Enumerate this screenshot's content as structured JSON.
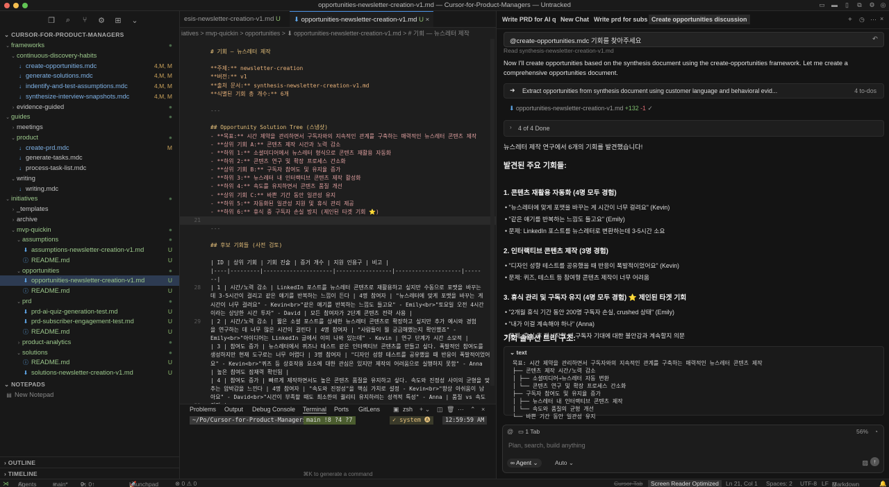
{
  "window": {
    "title": "opportunities-newsletter-creation-v1.md — Cursor-for-Product-Managers — Untracked"
  },
  "sidebar": {
    "project": "CURSOR-FOR-PRODUCT-MANAGERS",
    "tree": [
      {
        "label": "frameworks",
        "indent": 1,
        "type": "folder-open",
        "color": "green",
        "stat": "●"
      },
      {
        "label": "continuous-discovery-habits",
        "indent": 2,
        "type": "folder-open",
        "color": "green",
        "stat": ""
      },
      {
        "label": "create-opportunities.mdc",
        "indent": 3,
        "type": "file",
        "color": "blue",
        "stat": "4,M, M"
      },
      {
        "label": "generate-solutions.mdc",
        "indent": 3,
        "type": "file",
        "color": "blue",
        "stat": "4,M, M"
      },
      {
        "label": "indentify-and-test-assumptions.mdc",
        "indent": 3,
        "type": "file",
        "color": "blue",
        "stat": "4,M, M"
      },
      {
        "label": "synthesize-interview-snapshots.mdc",
        "indent": 3,
        "type": "file",
        "color": "blue",
        "stat": "4,M, M"
      },
      {
        "label": "evidence-guided",
        "indent": 2,
        "type": "folder",
        "color": "plain",
        "stat": "●"
      },
      {
        "label": "guides",
        "indent": 1,
        "type": "folder-open",
        "color": "green",
        "stat": "●"
      },
      {
        "label": "meetings",
        "indent": 2,
        "type": "folder",
        "color": "plain",
        "stat": ""
      },
      {
        "label": "product",
        "indent": 2,
        "type": "folder-open",
        "color": "green",
        "stat": "●"
      },
      {
        "label": "create-prd.mdc",
        "indent": 3,
        "type": "file",
        "color": "blue",
        "stat": "M"
      },
      {
        "label": "generate-tasks.mdc",
        "indent": 3,
        "type": "file",
        "color": "plain",
        "stat": ""
      },
      {
        "label": "process-task-list.mdc",
        "indent": 3,
        "type": "file",
        "color": "plain",
        "stat": ""
      },
      {
        "label": "writing",
        "indent": 2,
        "type": "folder-open",
        "color": "plain",
        "stat": ""
      },
      {
        "label": "writing.mdc",
        "indent": 3,
        "type": "file",
        "color": "plain",
        "stat": ""
      },
      {
        "label": "initiatives",
        "indent": 1,
        "type": "folder-open",
        "color": "green",
        "stat": "●"
      },
      {
        "label": "_templates",
        "indent": 2,
        "type": "folder",
        "color": "plain",
        "stat": ""
      },
      {
        "label": "archive",
        "indent": 2,
        "type": "folder",
        "color": "plain",
        "stat": ""
      },
      {
        "label": "mvp-quickin",
        "indent": 2,
        "type": "folder-open",
        "color": "green",
        "stat": "●"
      },
      {
        "label": "assumptions",
        "indent": 3,
        "type": "folder-open",
        "color": "green",
        "stat": "●"
      },
      {
        "label": "assumptions-newsletter-creation-v1.md",
        "indent": 4,
        "type": "file-down",
        "color": "green",
        "stat": "U"
      },
      {
        "label": "README.md",
        "indent": 4,
        "type": "file-info",
        "color": "green",
        "stat": "U"
      },
      {
        "label": "opportunities",
        "indent": 3,
        "type": "folder-open",
        "color": "green",
        "stat": "●"
      },
      {
        "label": "opportunities-newsletter-creation-v1.md",
        "indent": 4,
        "type": "file-down",
        "color": "green",
        "stat": "U",
        "selected": true
      },
      {
        "label": "README.md",
        "indent": 4,
        "type": "file-info",
        "color": "green",
        "stat": "U"
      },
      {
        "label": "prd",
        "indent": 3,
        "type": "folder-open",
        "color": "green",
        "stat": "●"
      },
      {
        "label": "prd-ai-quiz-generation-test.md",
        "indent": 4,
        "type": "file-down",
        "color": "green",
        "stat": "U"
      },
      {
        "label": "prd-subscriber-engagement-test.md",
        "indent": 4,
        "type": "file-down",
        "color": "green",
        "stat": "U"
      },
      {
        "label": "README.md",
        "indent": 4,
        "type": "file-info",
        "color": "green",
        "stat": "U"
      },
      {
        "label": "product-analytics",
        "indent": 3,
        "type": "folder",
        "color": "green",
        "stat": "●"
      },
      {
        "label": "solutions",
        "indent": 3,
        "type": "folder-open",
        "color": "green",
        "stat": "●"
      },
      {
        "label": "README.md",
        "indent": 4,
        "type": "file-info",
        "color": "green",
        "stat": "U"
      },
      {
        "label": "solutions-newsletter-creation-v1.md",
        "indent": 4,
        "type": "file-down",
        "color": "green",
        "stat": "U"
      }
    ],
    "notepads_section": "NOTEPADS",
    "new_notepad": "New Notepad",
    "outline_section": "OUTLINE",
    "timeline_section": "TIMELINE"
  },
  "editor": {
    "tabs": [
      {
        "label": "esis-newsletter-creation-v1.md",
        "status": "U",
        "active": false
      },
      {
        "label": "opportunities-newsletter-creation-v1.md",
        "status": "U",
        "active": true
      }
    ],
    "breadcrumb": "iatives > mvp-quickin > opportunities > ⬇ opportunities-newsletter-creation-v1.md > # 기회 — 뉴스레터 제작",
    "lines": [
      {
        "n": "",
        "t": "# 기회 — 뉴스레터 제작",
        "k": "h"
      },
      {
        "n": "",
        "t": "",
        "k": ""
      },
      {
        "n": "",
        "t": "**주제:** newsletter-creation",
        "k": "kv"
      },
      {
        "n": "",
        "t": "**버전:** v1",
        "k": "kv"
      },
      {
        "n": "",
        "t": "**출처 문서:** synthesis-newsletter-creation-v1.md",
        "k": "kv"
      },
      {
        "n": "",
        "t": "**식별된 기회 총 개수:** 6개",
        "k": "kv"
      },
      {
        "n": "",
        "t": "",
        "k": ""
      },
      {
        "n": "",
        "t": "---",
        "k": "dim"
      },
      {
        "n": "",
        "t": "",
        "k": ""
      },
      {
        "n": "",
        "t": "## Opportunity Solution Tree (스냅샷)",
        "k": "h"
      },
      {
        "n": "",
        "t": "- **목표:** 시간 제약을 관리하면서 구독자와의 지속적인 관계를 구축하는 매력적인 뉴스레터 콘텐츠 제작",
        "k": "li"
      },
      {
        "n": "",
        "t": "  - **상위 기회 A:** 콘텐츠 제작 시간과 노력 감소",
        "k": "li"
      },
      {
        "n": "",
        "t": "    - **하위 1:** 소셜미디어에서 뉴스레터 형식으로 콘텐츠 재활용 자동화",
        "k": "li"
      },
      {
        "n": "",
        "t": "    - **하위 2:** 콘텐츠 연구 및 확장 프로세스 간소화",
        "k": "li"
      },
      {
        "n": "",
        "t": "  - **상위 기회 B:** 구독자 참여도 및 유지율 증가",
        "k": "li"
      },
      {
        "n": "",
        "t": "    - **하위 3:** 뉴스레터 내 인터랙티브 콘텐츠 제작 활성화",
        "k": "li"
      },
      {
        "n": "",
        "t": "    - **하위 4:** 속도를 유지하면서 콘텐츠 품질 개선",
        "k": "li"
      },
      {
        "n": "",
        "t": "  - **상위 기회 C:** 바쁜 기간 동안 일관성 유지",
        "k": "li"
      },
      {
        "n": "",
        "t": "    - **하위 5:** 자동화된 일관성 지원 및 휴식 관리 제공",
        "k": "li"
      },
      {
        "n": "",
        "t": "    - **하위 6:** 휴식 중 구독자 손실 방지 (제인된 타겟 기회 ⭐)",
        "k": "li"
      },
      {
        "n": "21",
        "t": "",
        "k": "cur"
      },
      {
        "n": "",
        "t": "---",
        "k": "dim"
      },
      {
        "n": "",
        "t": "",
        "k": ""
      },
      {
        "n": "",
        "t": "## 후보 기회들 (사전 검토)",
        "k": "h"
      },
      {
        "n": "",
        "t": "",
        "k": ""
      },
      {
        "n": "",
        "t": "| ID | 상위 기회 | 기회 진술 | 증거 개수 | 지원 인용구 | 비고 |",
        "k": ""
      },
      {
        "n": "",
        "t": "|----|---------|---------------------|-----------------|--------------------|-----",
        "k": ""
      },
      {
        "n": "",
        "t": "--|",
        "k": ""
      },
      {
        "n": "28",
        "t": "| 1 | 시간/노력 감소 | LinkedIn 포스트를 뉴스레터 콘텐츠로 재활용하고 싶지만 수동으로 포맷을 바꾸는",
        "k": ""
      },
      {
        "n": "",
        "t": "데 3-5시간이 걸리고 같은 얘기를 반복하는 느낌이 든다 | 4명 참여자 | \"뉴스레터에 맞게 포맷을 바꾸는 게",
        "k": ""
      },
      {
        "n": "",
        "t": "시간이 너무 걸려요\" - Kevin<br>\"같은 얘기를 반복하는 느낌도 들고요\" - Emily<br>\"토요일 오전 4시간",
        "k": ""
      },
      {
        "n": "",
        "t": "이라는 상당한 시간 투자\" - David | 모든 참여자가 2단계 콘텐츠 전략 사용 |",
        "k": ""
      },
      {
        "n": "29",
        "t": "| 2 | 시간/노력 감소 | 짧은 소셜 포스트를 상세한 뉴스레터 콘텐츠로 확장하고 싶지만 추가 예시와 경험",
        "k": ""
      },
      {
        "n": "",
        "t": "을 연구하는 데 너무 많은 시간이 걸린다 | 4명 참여자 | \"사람들이 뭘 궁금해했는지 확인했죠\" -",
        "k": ""
      },
      {
        "n": "",
        "t": "Emily<br>\"아이디어는 LinkedIn 글에서 이미 나와 있는데\" - Kevin | 연구 단계가 시간 소모적 |",
        "k": ""
      },
      {
        "n": "",
        "t": "| 3 | 참여도 증가 | 뉴스레터에서 퀴즈나 테스트 같은 인터랙티브 콘텐츠를 만들고 싶다. 폭발적인 참여도를",
        "k": ""
      },
      {
        "n": "",
        "t": "생성하지만 현재 도구로는 너무 어렵다 | 3명 참여자 | \"디자인 성향 테스트를 공유했을 때 반응이 폭발적이었어",
        "k": ""
      },
      {
        "n": "",
        "t": "요\" - Kevin<br>\"퀴즈 등 상호작용 요소에 대한 관심은 있지만 제작의 어려움으로 실행하지 못함\" - Anna",
        "k": ""
      },
      {
        "n": "",
        "t": "| 높은 참여도 잠재력 확인됨 |",
        "k": ""
      },
      {
        "n": "",
        "t": "| 4 | 참여도 증가 | 빠르게 제작하면서도 높은 콘텐츠 품질을 유지하고 싶다. 속도와 진정성 사이의 균형을 맞",
        "k": ""
      },
      {
        "n": "",
        "t": "추는 압박감을 느낀다 | 4명 참여자 | \"속도와 진정성\"을 핵심 가치로 설정 - Kevin<br>\"항상 아쉬움이 남",
        "k": ""
      },
      {
        "n": "",
        "t": "아요\" - David<br>\"시간이 부족할 때도 최소한의 퀄리티 유지하려는 성격적 특성\" - Anna | 품질 vs 속도",
        "k": ""
      },
      {
        "n": "31",
        "t": "긴장 |",
        "k": ""
      }
    ]
  },
  "terminal": {
    "tabs": [
      "Problems",
      "Output",
      "Debug Console",
      "Terminal",
      "Ports",
      "GitLens"
    ],
    "shell": "zsh",
    "cwd": "~/Po/Cursor-for-Product-Managers",
    "branch": "main !8 ?4 ?7",
    "env": "✓ system 🅐",
    "time": "12:59:59 AM",
    "hint": "⌘K to generate a command"
  },
  "chat": {
    "tabs": [
      {
        "label": "Write PRD for AI q",
        "active": false
      },
      {
        "label": "New Chat",
        "active": false
      },
      {
        "label": "Write prd for subs",
        "active": false
      },
      {
        "label": "Create opportunities discussion",
        "active": true
      }
    ],
    "user_message": "@create-opportunities.mdc 기회를 찾아주세요",
    "read_line": "Read synthesis-newsletter-creation-v1.md",
    "intro": "Now I'll create opportunities based on the synthesis document using the create-opportunities framework. Let me create a",
    "intro2": "comprehensive opportunities document.",
    "todo_task": "Extract opportunities from synthesis document using customer language and behavioral evid...",
    "todo_count": "4 to-dos",
    "file_change": "opportunities-newsletter-creation-v1.md",
    "file_add": "+132",
    "file_del": "-1",
    "done": "4 of 4 Done",
    "summary": "뉴스레터 제작 연구에서 6개의 기회를 발견했습니다!",
    "found_heading": "발견된 주요 기회들:",
    "sections": [
      {
        "heading": "1. 콘텐츠 재활용 자동화 (4명 모두 경험)",
        "bullets": [
          "\"뉴스레터에 맞게 포맷을 바꾸는 게 시간이 너무 걸려요\" (Kevin)",
          "\"같은 얘기를 반복하는 느낌도 들고요\" (Emily)",
          "문제: LinkedIn 포스트를 뉴스레터로 변환하는데 3-5시간 소요"
        ]
      },
      {
        "heading": "2. 인터랙티브 콘텐츠 제작 (3명 경험)",
        "bullets": [
          "\"디자인 성향 테스트를 공유했을 때 반응이 폭발적이었어요\" (Kevin)",
          "문제: 퀴즈, 테스트 등 참여형 콘텐츠 제작이 너무 어려움"
        ]
      },
      {
        "heading": "3. 휴식 관리 및 구독자 유지 (4명 모두 경험) ⭐ 제인된 타겟 기회",
        "bullets": [
          "\"2개월 휴식 기간 동안 200명 구독자 손실, crushed 상태\" (Emily)",
          "\"내가 이걸 계속해야 하나\" (Anna)",
          "문제: 휴식 후 재시작할 때 구독자 기대에 대한 불안감과 계속할지 의문"
        ]
      }
    ],
    "tree_heading": "기회 솔루션 트리 구조:",
    "code_label": "text",
    "code_lines": [
      "목표: 시간 제약을 관리하면서 구독자와의 지속적인 관계를 구축하는 매력적인 뉴스레터 콘텐츠 제작",
      "├── 콘텐츠 제작 시간/노력 감소",
      "│   ├── 소셜미디어→뉴스레터 자동 변환",
      "│   └── 콘텐츠 연구 및 확장 프로세스 간소화",
      "├── 구독자 참여도 및 유지율 증가",
      "│   ├── 뉴스레터 내 인터랙티브 콘텐츠 제작",
      "│   └── 속도와 품질의 균형 개선",
      "└── 바쁜 기간 동안 일관성 유지"
    ],
    "composer": {
      "tab_count": "1 Tab",
      "percent": "56%",
      "placeholder": "Plan, search, build anything",
      "agent": "∞ Agent",
      "auto": "Auto"
    }
  },
  "statusbar": {
    "agents": "Agents",
    "branch": "main*",
    "sync": "9↓ 0↑",
    "launchpad": "Launchpad",
    "problems": "⊗ 0 ⚠ 0",
    "cursor_tab": "Cursor Tab",
    "screen_reader": "Screen Reader Optimized",
    "position": "Ln 21, Col 1",
    "spaces": "Spaces: 2",
    "encoding": "UTF-8",
    "eol": "LF",
    "language": "Markdown"
  }
}
